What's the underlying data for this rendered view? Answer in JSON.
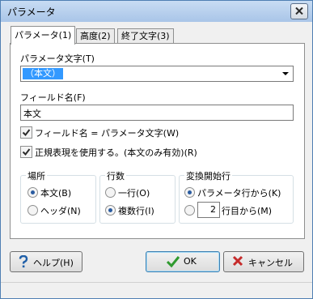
{
  "window": {
    "title": "パラメータ"
  },
  "tabs": [
    {
      "label": "パラメータ(1)"
    },
    {
      "label": "高度(2)"
    },
    {
      "label": "終了文字(3)"
    }
  ],
  "param_char": {
    "label": "パラメータ文字(T)",
    "value": "（本文）"
  },
  "field_name": {
    "label": "フィールド名(F)",
    "value": "本文"
  },
  "checkboxes": [
    {
      "label": "フィールド名 = パラメータ文字(W)",
      "checked": true
    },
    {
      "label": "正規表現を使用する。(本文のみ有効)(R)",
      "checked": true
    }
  ],
  "groups": {
    "location": {
      "title": "場所",
      "options": [
        "本文(B)",
        "ヘッダ(N)"
      ],
      "selected": 0
    },
    "lines": {
      "title": "行数",
      "options": [
        "一行(O)",
        "複数行(I)"
      ],
      "selected": 1
    },
    "start": {
      "title": "変換開始行",
      "option1": "パラメータ行から(K)",
      "line_value": "2",
      "option2_suffix": "行目から(M)",
      "selected": 0
    }
  },
  "buttons": {
    "help": "ヘルプ(H)",
    "ok": "OK",
    "cancel": "キャンセル"
  },
  "colors": {
    "accent": "#3399ff",
    "title_bar": "#b9d1ee"
  }
}
